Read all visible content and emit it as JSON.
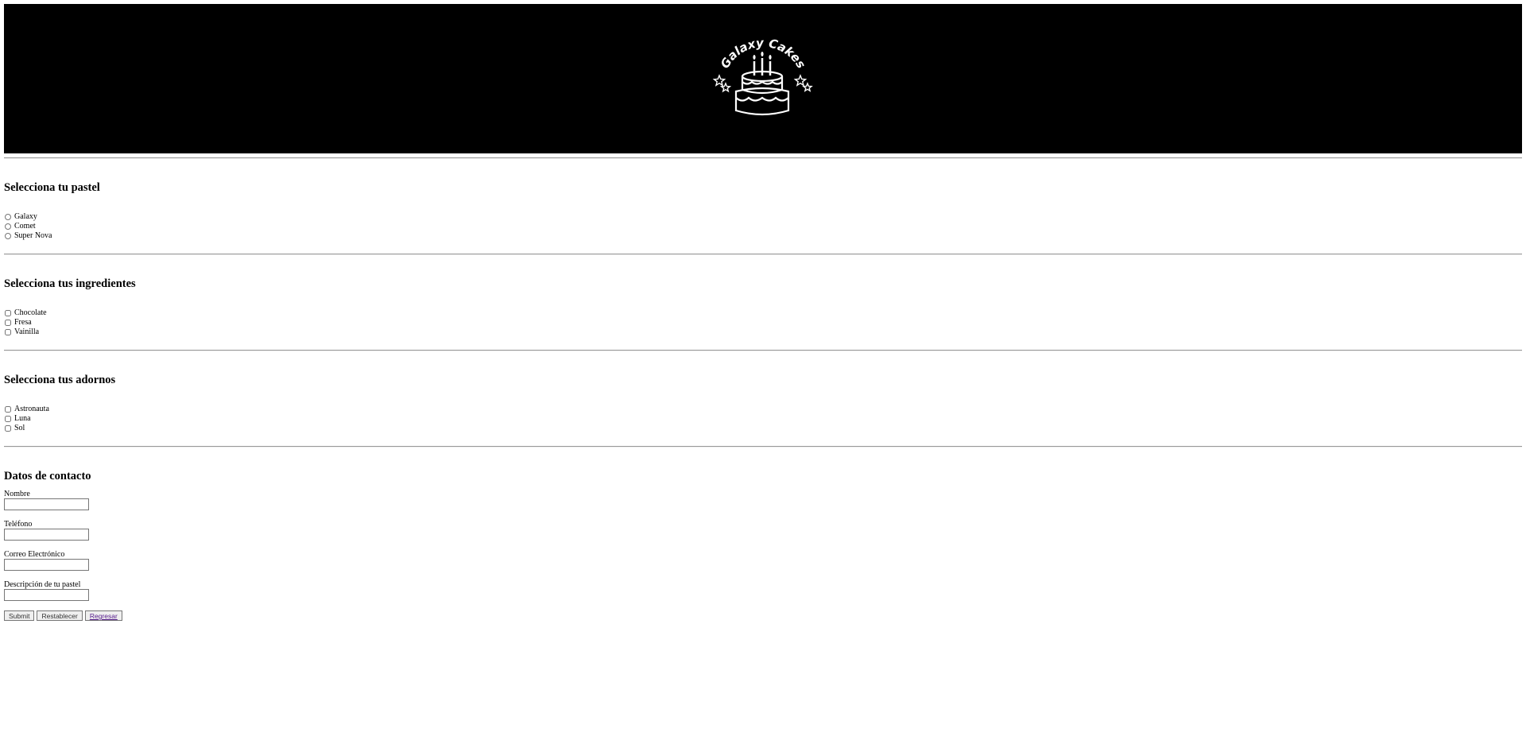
{
  "header": {
    "logo_text": "Galaxy Cakes",
    "logo_icon": "birthday-cake-icon"
  },
  "sections": {
    "pastel": {
      "title": "Selecciona tu pastel",
      "options": [
        "Galaxy",
        "Comet",
        "Super Nova"
      ]
    },
    "ingredientes": {
      "title": "Selecciona tus ingredientes",
      "options": [
        "Chocolate",
        "Fresa",
        "Vainilla"
      ]
    },
    "adornos": {
      "title": "Selecciona tus adornos",
      "options": [
        "Astronauta",
        "Luna",
        "Sol"
      ]
    }
  },
  "contact": {
    "title": "Datos de contacto",
    "fields": [
      {
        "label": "Nombre",
        "value": ""
      },
      {
        "label": "Teléfono",
        "value": ""
      },
      {
        "label": "Correo Electrónico",
        "value": ""
      },
      {
        "label": "Descripción de tu pastel",
        "value": ""
      }
    ]
  },
  "buttons": {
    "submit": "Submit",
    "reset": "Restablecer",
    "back": "Regresar"
  }
}
